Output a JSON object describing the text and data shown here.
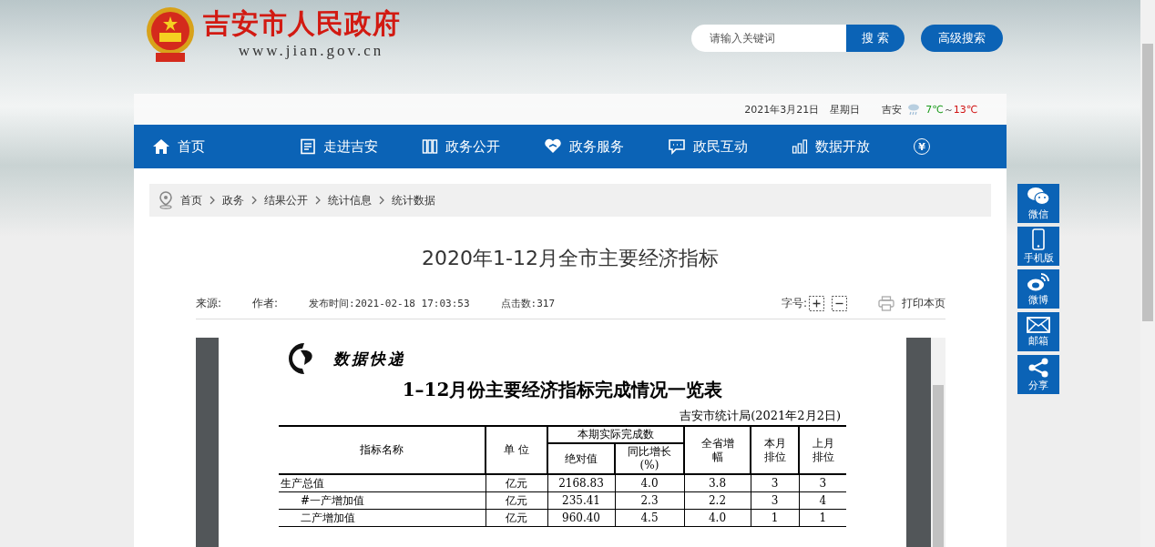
{
  "header": {
    "site_title": "吉安市人民政府",
    "site_url": "www.jian.gov.cn",
    "search": {
      "placeholder": "请输入关键词"
    },
    "search_button": "搜 索",
    "advanced_button": "高级搜索"
  },
  "topbar": {
    "date": "2021年3月21日",
    "weekday": "星期日",
    "city": "吉安",
    "temp_low": "7℃",
    "temp_sep": "～",
    "temp_high": "13℃"
  },
  "nav": [
    {
      "label": "首页"
    },
    {
      "label": "走进吉安"
    },
    {
      "label": "政务公开"
    },
    {
      "label": "政务服务"
    },
    {
      "label": "政民互动"
    },
    {
      "label": "数据开放"
    },
    {
      "label": "¥"
    }
  ],
  "breadcrumb": [
    "首页",
    "政务",
    "结果公开",
    "统计信息",
    "统计数据"
  ],
  "article": {
    "title": "2020年1-12月全市主要经济指标",
    "source": "来源:",
    "author": "作者:",
    "published": "发布时间:2021-02-18 17:03:53",
    "clicks": "点击数:317",
    "font_size_label": "字号:",
    "print": "打印本页"
  },
  "document": {
    "logo_text": "数据快递",
    "title": "1–12月份主要经济指标完成情况一览表",
    "issuer": "吉安市统计局(2021年2月2日)",
    "head": {
      "name": "指标名称",
      "unit": "单 位",
      "group": "本期实际完成数",
      "absolute": "绝对值",
      "yoy": "同比增长(%)",
      "province": "全省增幅",
      "rank_this": "本月排位",
      "rank_last": "上月排位"
    },
    "rows": [
      {
        "cells": [
          "生产总值",
          "亿元",
          "2168.83",
          "4.0",
          "3.8",
          "3",
          "3"
        ],
        "children": [
          {
            "cells": [
              "#一产增加值",
              "亿元",
              "235.41",
              "2.3",
              "2.2",
              "3",
              "4"
            ]
          },
          {
            "cells": [
              "二产增加值",
              "亿元",
              "960.40",
              "4.5",
              "4.0",
              "1",
              "1"
            ]
          }
        ]
      }
    ]
  },
  "sidebar": [
    {
      "label": "微信"
    },
    {
      "label": "手机版"
    },
    {
      "label": "微博"
    },
    {
      "label": "邮箱"
    },
    {
      "label": "分享"
    }
  ]
}
